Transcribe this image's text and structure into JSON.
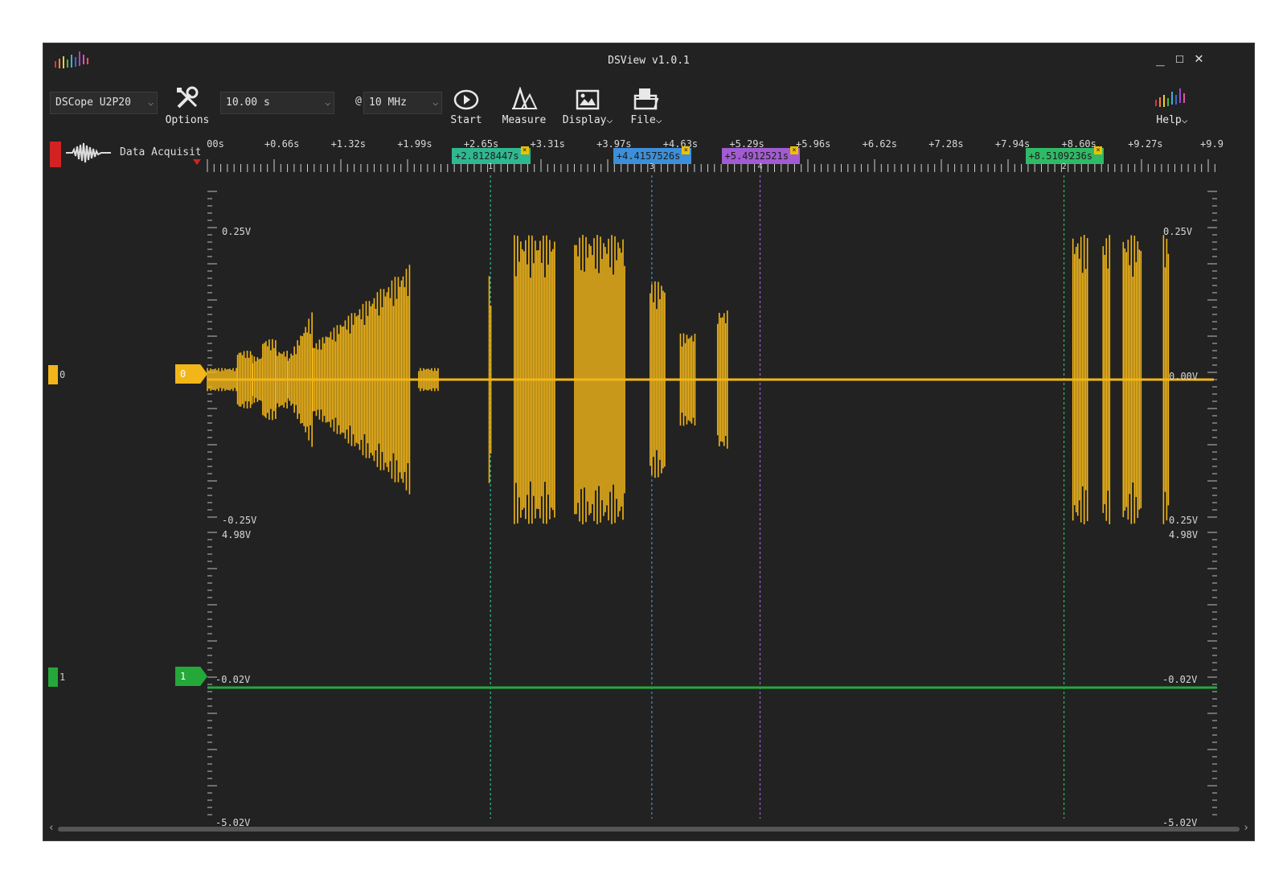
{
  "window": {
    "title": "DSView v1.0.1"
  },
  "toolbar": {
    "device": "DSCope U2P20",
    "options_label": "Options",
    "duration": "10.00 s",
    "at_symbol": "@",
    "samplerate": "10 MHz",
    "start_label": "Start",
    "measure_label": "Measure",
    "display_label": "Display",
    "file_label": "File",
    "help_label": "Help"
  },
  "ruler": {
    "daq_label": "Data Acquisition",
    "ticks": [
      "00s",
      "+0.66s",
      "+1.32s",
      "+1.99s",
      "+2.65s",
      "+3.31s",
      "+3.97s",
      "+4.63s",
      "+5.29s",
      "+5.96s",
      "+6.62s",
      "+7.28s",
      "+7.94s",
      "+8.60s",
      "+9.27s",
      "+9.9"
    ],
    "cursors": [
      {
        "label": "+2.8128447s",
        "index": "1",
        "color": "#2fb890",
        "time": 2.8128447
      },
      {
        "label": "+4.4157526s",
        "index": "3",
        "color": "#3c8fd8",
        "time": 4.4157526
      },
      {
        "label": "+5.4912521s",
        "index": "4",
        "color": "#a25bd2",
        "time": 5.4912521
      },
      {
        "label": "+8.5109236s",
        "index": "2",
        "color": "#2fba66",
        "time": 8.5109236
      }
    ]
  },
  "channels": [
    {
      "id": "0",
      "color": "#f2b619",
      "vmax_left": "0.25V",
      "vmin_left": "-0.25V",
      "vmax_right": "0.25V",
      "vzero_right": "0.00V",
      "vmin_right": "0.25V"
    },
    {
      "id": "1",
      "color": "#25a83a",
      "vmax_left": "4.98V",
      "vzero_left": "-0.02V",
      "vmin_left": "-5.02V",
      "vmax_right": "4.98V",
      "vzero_right": "-0.02V",
      "vmin_right": "-5.02V"
    }
  ]
}
